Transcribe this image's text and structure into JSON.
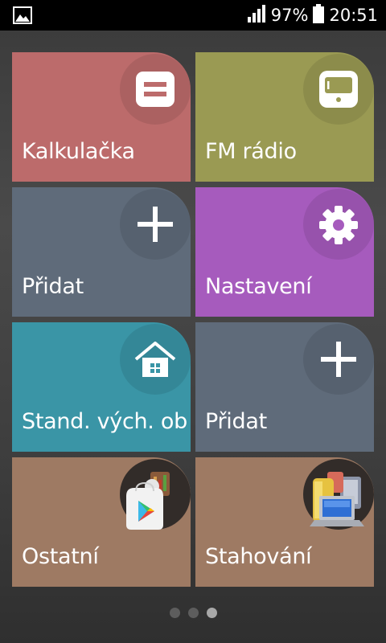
{
  "status_bar": {
    "battery": "97%",
    "time": "20:51",
    "left_icon": "image-icon",
    "signal_icon": "signal-icon",
    "battery_icon": "battery-icon"
  },
  "tiles": [
    {
      "label": "Kalkulačka",
      "color": "#bc6b6b",
      "icon": "calculator-icon"
    },
    {
      "label": "FM rádio",
      "color": "#9a9a53",
      "icon": "radio-icon"
    },
    {
      "label": "Přidat",
      "color": "#5f6b7a",
      "icon": "plus-icon"
    },
    {
      "label": "Nastavení",
      "color": "#a65bbd",
      "icon": "gear-icon"
    },
    {
      "label": "Stand. vých. ob",
      "color": "#3a95a6",
      "icon": "home-icon"
    },
    {
      "label": "Přidat",
      "color": "#5f6b7a",
      "icon": "plus-icon"
    },
    {
      "label": "Ostatní",
      "color": "#9e7a63",
      "icon": "play-store-icon"
    },
    {
      "label": "Stahování",
      "color": "#9e7a63",
      "icon": "downloads-folder-icon"
    }
  ],
  "pager": {
    "count": 3,
    "active": 3
  }
}
